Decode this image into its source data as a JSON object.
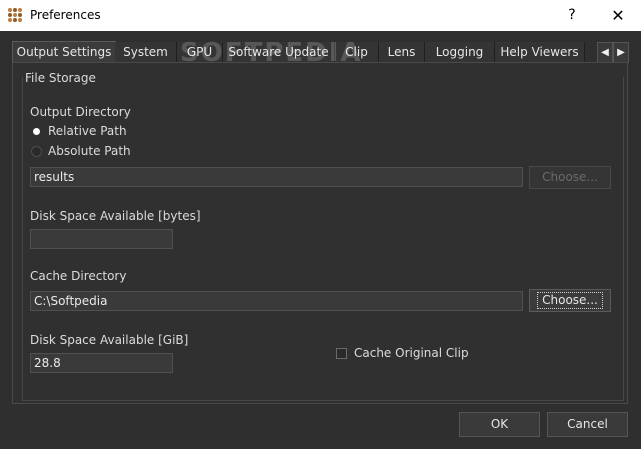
{
  "window": {
    "title": "Preferences",
    "help_glyph": "?",
    "close_glyph": "✕"
  },
  "tabs": [
    {
      "label": "Output Settings"
    },
    {
      "label": "System"
    },
    {
      "label": "GPU"
    },
    {
      "label": "Software Update"
    },
    {
      "label": "Clip"
    },
    {
      "label": "Lens"
    },
    {
      "label": "Logging"
    },
    {
      "label": "Help Viewers"
    }
  ],
  "tab_nav": {
    "prev": "◀",
    "next": "▶"
  },
  "watermark": "SOFTPEDIA",
  "file_storage": {
    "title": "File Storage",
    "output_directory_label": "Output Directory",
    "relative_path_label": "Relative Path",
    "absolute_path_label": "Absolute Path",
    "output_path_value": "results",
    "choose_disabled_label": "Choose...",
    "disk_space_bytes_label": "Disk Space Available [bytes]",
    "disk_space_bytes_value": "",
    "cache_directory_label": "Cache Directory",
    "cache_path_value": "C:\\Softpedia",
    "choose_label": "Choose...",
    "disk_space_gib_label": "Disk Space Available [GiB]",
    "disk_space_gib_value": "28.8",
    "cache_original_clip_label": "Cache Original Clip"
  },
  "footer": {
    "ok_label": "OK",
    "cancel_label": "Cancel"
  }
}
